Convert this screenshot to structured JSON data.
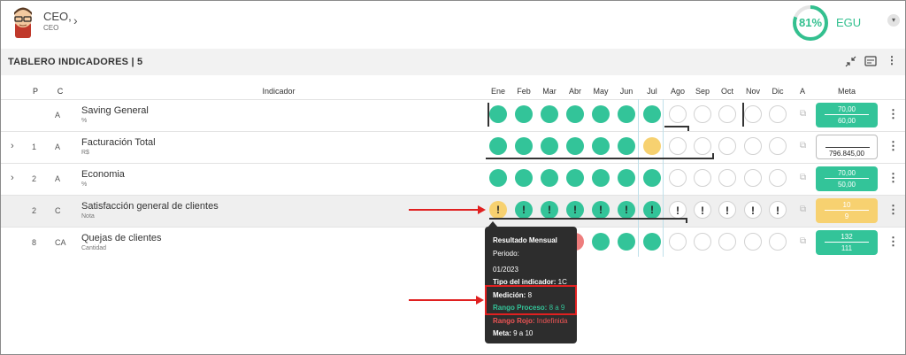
{
  "header": {
    "user_name": "CEO,",
    "user_role": "CEO",
    "gauge_value": "81%",
    "gauge_fraction": 0.81,
    "org": "EGU"
  },
  "toolbar": {
    "title": "TABLERO INDICADORES | 5"
  },
  "columns": {
    "p": "P",
    "c": "C",
    "indicador": "Indicador",
    "months": [
      "Ene",
      "Feb",
      "Mar",
      "Abr",
      "May",
      "Jun",
      "Jul",
      "Ago",
      "Sep",
      "Oct",
      "Nov",
      "Dic"
    ],
    "a": "A",
    "meta": "Meta"
  },
  "rows": [
    {
      "p": "",
      "c": "A",
      "name": "Saving General",
      "unit": "%",
      "expandable": false,
      "status": [
        "g",
        "g",
        "g",
        "g",
        "g",
        "g",
        "g",
        "e",
        "e",
        "e",
        "e",
        "e"
      ],
      "meta_top": "70,00",
      "meta_bottom": "60,00",
      "meta_color": "g"
    },
    {
      "p": "1",
      "c": "A",
      "name": "Facturación Total",
      "unit": "R$",
      "expandable": true,
      "status": [
        "g",
        "g",
        "g",
        "g",
        "g",
        "g",
        "y",
        "e",
        "e",
        "e",
        "e",
        "e"
      ],
      "meta_top": "",
      "meta_bottom": "796.845,00",
      "meta_color": "w"
    },
    {
      "p": "2",
      "c": "A",
      "name": "Economia",
      "unit": "%",
      "expandable": true,
      "status": [
        "g",
        "g",
        "g",
        "g",
        "g",
        "g",
        "g",
        "e",
        "e",
        "e",
        "e",
        "e"
      ],
      "meta_top": "70,00",
      "meta_bottom": "50,00",
      "meta_color": "g"
    },
    {
      "p": "2",
      "c": "C",
      "name": "Satisfacción general de clientes",
      "unit": "Nota",
      "expandable": false,
      "status": [
        "y",
        "g",
        "g",
        "g",
        "g",
        "g",
        "g",
        "e",
        "e",
        "e",
        "e",
        "e"
      ],
      "mark": "!",
      "meta_top": "10",
      "meta_bottom": "9",
      "meta_color": "y"
    },
    {
      "p": "8",
      "c": "CA",
      "name": "Quejas de clientes",
      "unit": "Cantidad",
      "expandable": false,
      "status": [
        "",
        "",
        "",
        "r",
        "g",
        "g",
        "g",
        "e",
        "e",
        "e",
        "e",
        "e"
      ],
      "meta_top": "132",
      "meta_bottom": "111",
      "meta_color": "g"
    }
  ],
  "tooltip": {
    "title": "Resultado Mensual",
    "periodo_label": "Periodo:",
    "periodo_value": "01/2023",
    "tipo_label": "Tipo del indicador:",
    "tipo_value": "1C",
    "medicion_label": "Medición:",
    "medicion_value": "8",
    "rango_proceso_label": "Rango Proceso:",
    "rango_proceso_value": "8 a 9",
    "rango_rojo_label": "Rango Rojo:",
    "rango_rojo_value": "Indefinida",
    "meta_label": "Meta:",
    "meta_value": "9 a 10"
  },
  "colors": {
    "green": "#33c499",
    "yellow": "#f7d170",
    "red": "#ee7d7d",
    "accent_red": "#e02020",
    "gauge": "#33c08f"
  },
  "icons": {
    "collapse": "collapse-arrows-icon",
    "card": "card-view-icon",
    "more": "kebab-menu-icon",
    "attachment": "paperclip-icon",
    "expand": "chevron-right-icon"
  }
}
